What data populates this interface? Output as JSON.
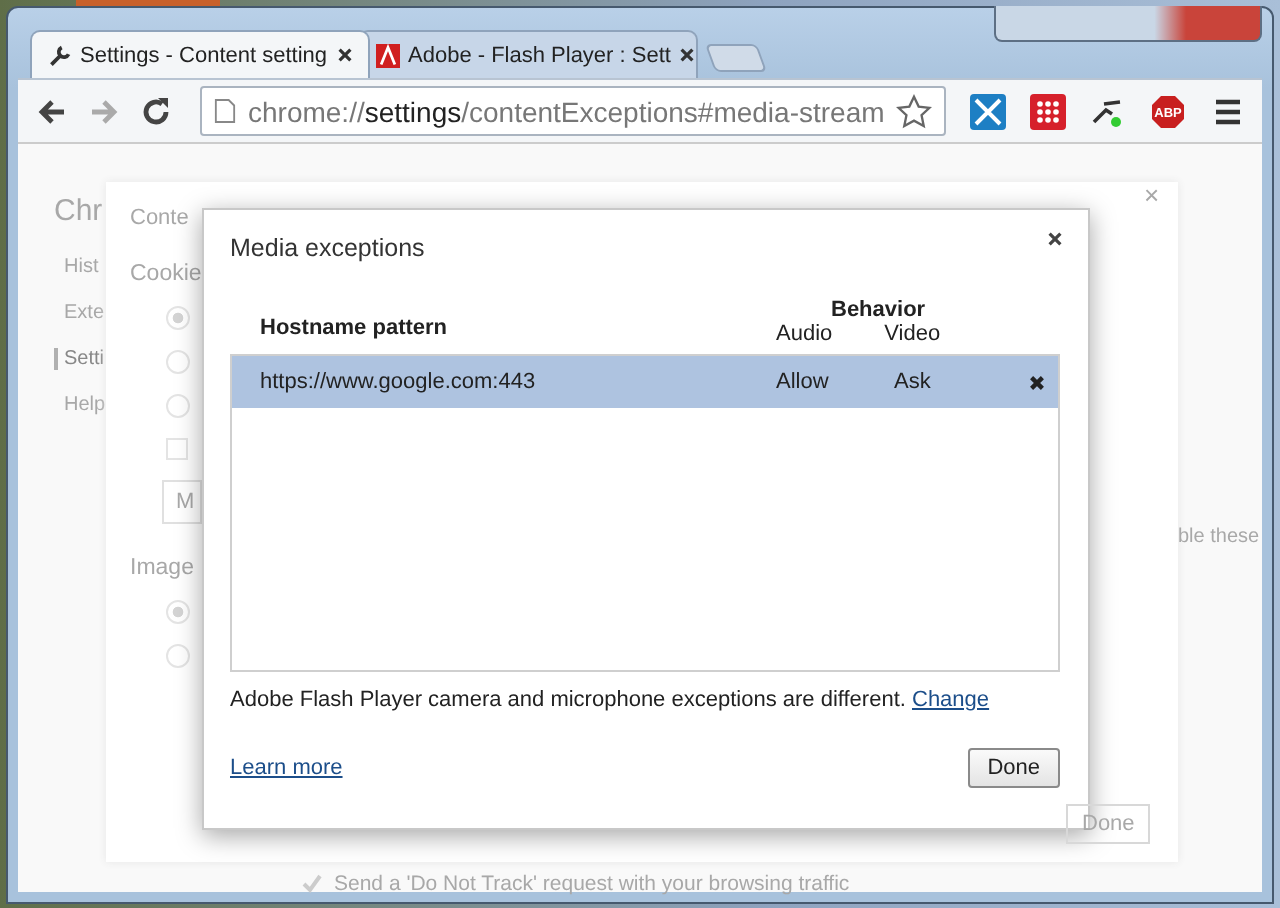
{
  "tabs": [
    {
      "label": "Settings - Content setting",
      "selected": true
    },
    {
      "label": "Adobe - Flash Player : Sett",
      "selected": false
    }
  ],
  "adblock_label": "ABP",
  "address": {
    "scheme": "chrome://",
    "host": "settings",
    "path": "/contentExceptions#media-stream"
  },
  "background": {
    "title": "Chr",
    "sidebar": [
      {
        "label": "Hist",
        "selected": false
      },
      {
        "label": "Exte",
        "selected": false
      },
      {
        "label": "Setti",
        "selected": true
      },
      {
        "label": "Help",
        "selected": false
      }
    ],
    "dialog_title": "Conte",
    "sections": [
      {
        "kind": "heading",
        "label": "Cookie"
      },
      {
        "kind": "radio",
        "checked": true
      },
      {
        "kind": "radio",
        "checked": false
      },
      {
        "kind": "radio",
        "checked": false
      },
      {
        "kind": "checkbox",
        "checked": false
      },
      {
        "kind": "button",
        "label": "M"
      },
      {
        "kind": "heading",
        "label": "Image"
      },
      {
        "kind": "radio",
        "checked": true
      },
      {
        "kind": "radio",
        "checked": false
      }
    ],
    "side_text": "ble these",
    "done": "Done",
    "close": "×",
    "dnt": {
      "label": "Send a 'Do Not Track' request with your browsing traffic",
      "checked": true
    }
  },
  "dialog": {
    "title": "Media exceptions",
    "columns": {
      "pattern": "Hostname pattern",
      "behavior": "Behavior",
      "audio": "Audio",
      "video": "Video"
    },
    "rows": [
      {
        "pattern": "https://www.google.com:443",
        "audio": "Allow",
        "video": "Ask",
        "selected": true
      }
    ],
    "note": "Adobe Flash Player camera and microphone exceptions are different.",
    "note_link": "Change",
    "learn_more": "Learn more",
    "done": "Done"
  }
}
